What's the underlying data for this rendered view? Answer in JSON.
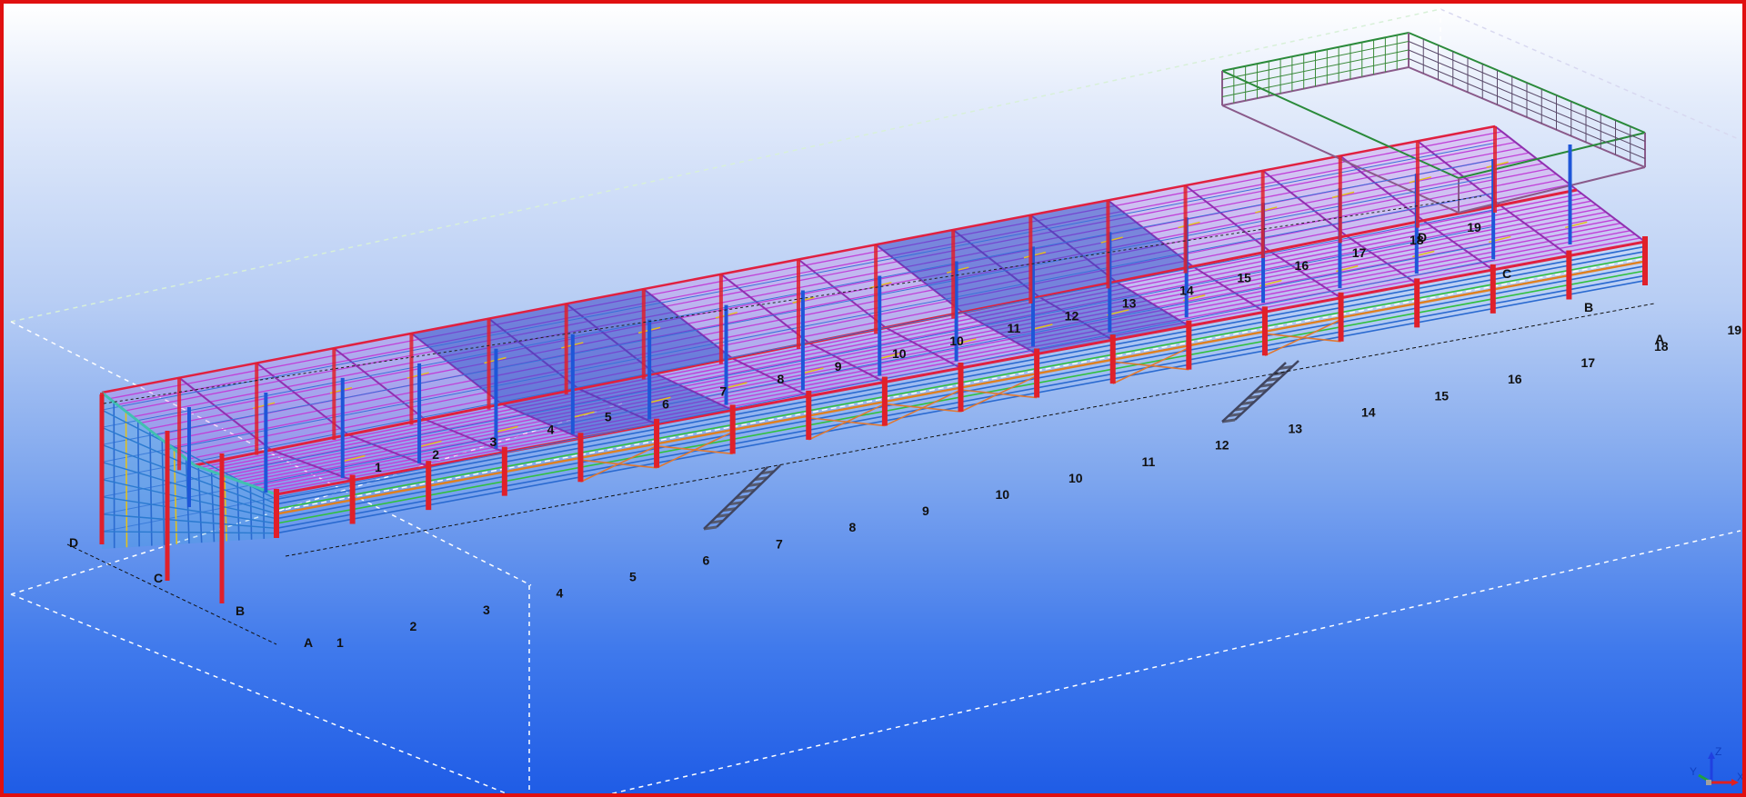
{
  "viewport": {
    "border_color": "#e01010",
    "background_top": "#ffffff",
    "background_bottom": "#1f5ce6"
  },
  "colors": {
    "columns": "#e0202a",
    "roof_purlins": "#c040d8",
    "roof_blue": "#2a50c8",
    "girts": "#2a6ad0",
    "bracing": "#20c040",
    "flange": "#e0c020",
    "stairs": "#555a70"
  },
  "grids": {
    "front_numbers": [
      "1",
      "2",
      "3",
      "4",
      "5",
      "6",
      "7",
      "8",
      "9",
      "10",
      "10",
      "11",
      "12",
      "13",
      "14",
      "15",
      "16",
      "17",
      "18",
      "19"
    ],
    "back_numbers": [
      "1",
      "2",
      "3",
      "4",
      "5",
      "6",
      "7",
      "8",
      "9",
      "10",
      "10",
      "11",
      "12",
      "13",
      "14",
      "15",
      "16",
      "17",
      "18",
      "19"
    ],
    "left_letters": [
      "D",
      "C",
      "B",
      "A"
    ],
    "right_letters": [
      "D",
      "C",
      "B",
      "A"
    ]
  },
  "axis_gizmo": {
    "x": "X",
    "y": "Y",
    "z": "Z",
    "icon": "axis-gizmo-icon"
  }
}
